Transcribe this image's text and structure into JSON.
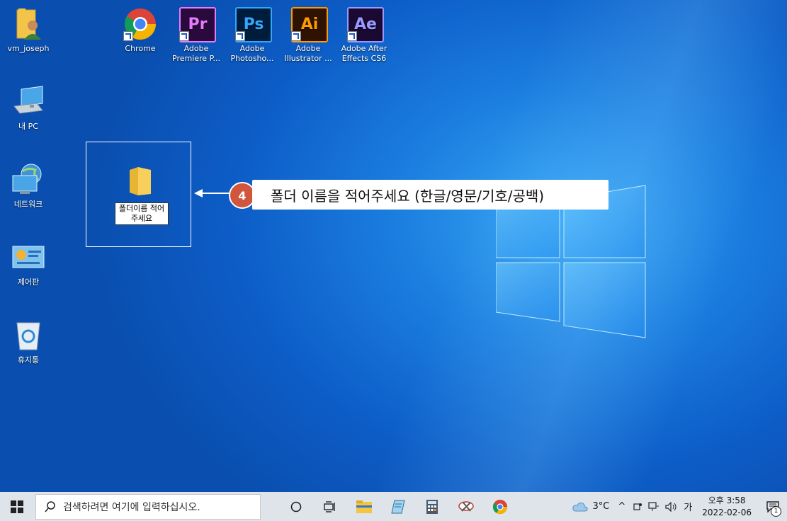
{
  "desktop": {
    "icons": [
      {
        "label": "vm_joseph"
      },
      {
        "label": "내 PC"
      },
      {
        "label": "네트워크"
      },
      {
        "label": "제어판"
      },
      {
        "label": "휴지통"
      },
      {
        "label": "Chrome"
      },
      {
        "label": "Adobe Premiere P..."
      },
      {
        "label": "Adobe Photosho..."
      },
      {
        "label": "Adobe Illustrator ..."
      },
      {
        "label": "Adobe After Effects CS6"
      }
    ],
    "adobe": {
      "pr": "Pr",
      "ps": "Ps",
      "ai": "Ai",
      "ae": "Ae"
    },
    "new_folder": {
      "name_value": "폴더이름 적어주세요"
    }
  },
  "instruction": {
    "step": "4",
    "text": "폴더 이름을 적어주세요 (한글/영문/기호/공백)"
  },
  "taskbar": {
    "search_placeholder": "검색하려면 여기에 입력하십시오.",
    "weather": "3°C",
    "ime": "가",
    "time": "오후 3:58",
    "date": "2022-02-06",
    "notification_count": "1"
  },
  "colors": {
    "accent_badge": "#d0573d",
    "premiere_bg": "#2a0a3d",
    "premiere_fg": "#e77bff",
    "photoshop_bg": "#001c3d",
    "photoshop_fg": "#31a8ff",
    "illustrator_bg": "#2e1400",
    "illustrator_fg": "#ff9a00",
    "aftereffects_bg": "#1a0a33",
    "aftereffects_fg": "#9999ff"
  }
}
